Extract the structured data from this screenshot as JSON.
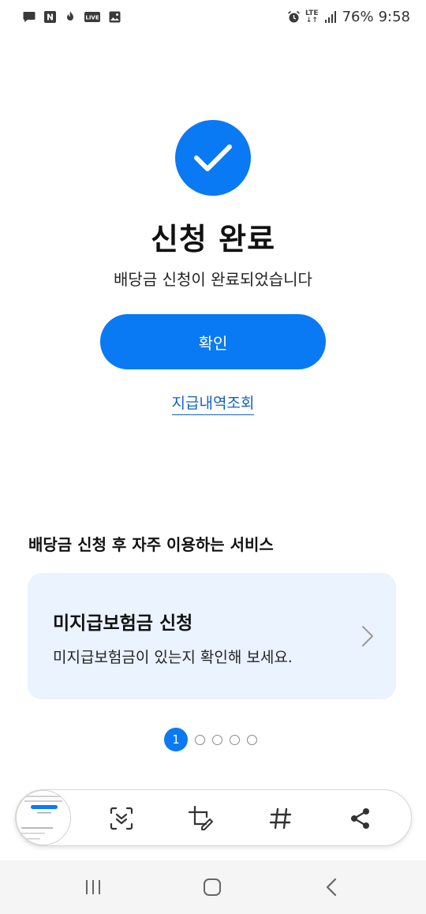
{
  "status_bar": {
    "battery": "76%",
    "time": "9:58",
    "network": "LTE",
    "left_icons": [
      "chat-icon",
      "naver-icon",
      "fire-icon",
      "live-icon",
      "gallery-icon"
    ],
    "right_icons": [
      "alarm-icon",
      "lte-icon",
      "signal-icon"
    ]
  },
  "completion": {
    "icon": "checkmark-icon",
    "title": "신청 완료",
    "subtitle": "배당금 신청이 완료되었습니다",
    "confirm_label": "확인",
    "history_link": "지급내역조회"
  },
  "services": {
    "heading": "배당금 신청 후 자주 이용하는 서비스",
    "card": {
      "title": "미지급보험금 신청",
      "description": "미지급보험금이 있는지 확인해 보세요."
    }
  },
  "pagination": {
    "current": "1",
    "total": 5
  },
  "toolbar": {
    "tools": [
      "scroll-capture-icon",
      "crop-edit-icon",
      "hashtag-icon",
      "share-icon"
    ]
  },
  "nav": {
    "buttons": [
      "recent-apps-icon",
      "home-icon",
      "back-icon"
    ]
  },
  "colors": {
    "accent": "#0a79f4",
    "card_bg": "#eaf3fe",
    "link": "#1560c4"
  }
}
